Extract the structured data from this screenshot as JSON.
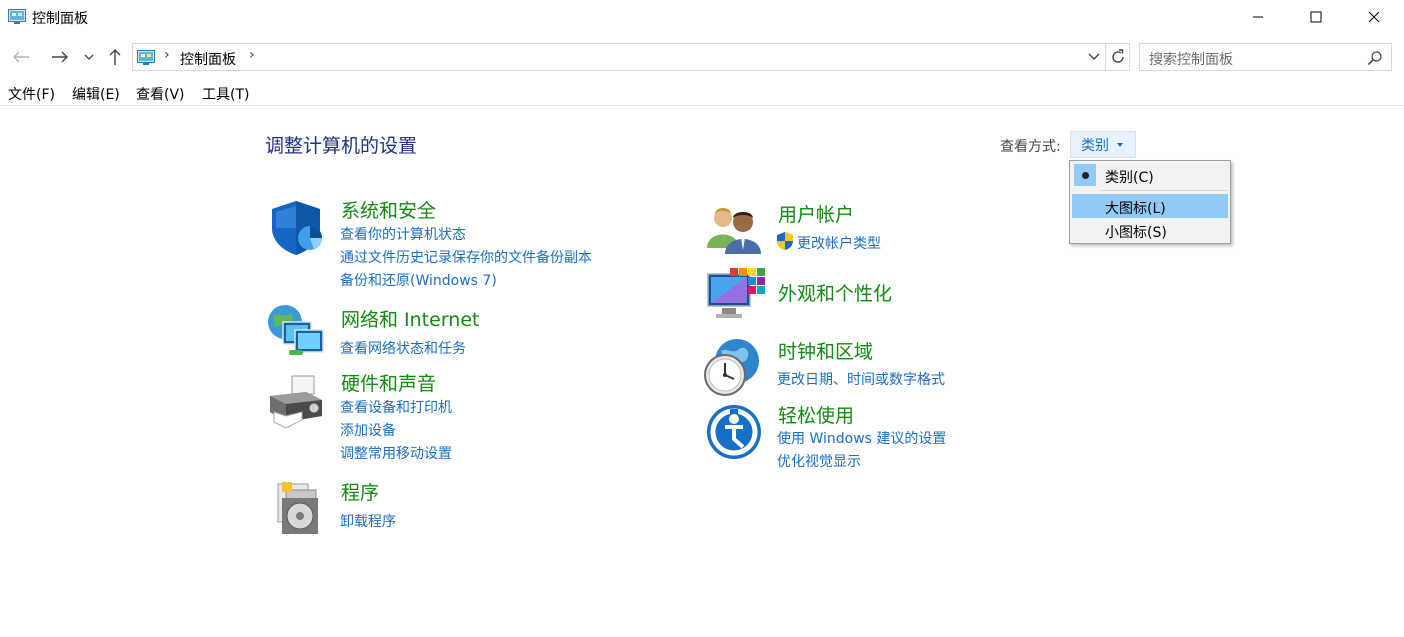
{
  "window": {
    "title": "控制面板"
  },
  "address": {
    "crumb": "控制面板",
    "separator": "›"
  },
  "search": {
    "placeholder": "搜索控制面板"
  },
  "menubar": {
    "file": "文件(F)",
    "edit": "编辑(E)",
    "view": "查看(V)",
    "tools": "工具(T)"
  },
  "main": {
    "title": "调整计算机的设置",
    "view_by_label": "查看方式:",
    "view_by_value": "类别"
  },
  "dropdown": {
    "items": [
      "类别(C)",
      "大图标(L)",
      "小图标(S)"
    ],
    "selected_index": 0,
    "highlighted_index": 1
  },
  "categories": {
    "security": {
      "title": "系统和安全",
      "links": [
        "查看你的计算机状态",
        "通过文件历史记录保存你的文件备份副本",
        "备份和还原(Windows 7)"
      ]
    },
    "network": {
      "title": "网络和 Internet",
      "links": [
        "查看网络状态和任务"
      ]
    },
    "hardware": {
      "title": "硬件和声音",
      "links": [
        "查看设备和打印机",
        "添加设备",
        "调整常用移动设置"
      ]
    },
    "programs": {
      "title": "程序",
      "links": [
        "卸载程序"
      ]
    },
    "accounts": {
      "title": "用户帐户",
      "links": [
        "更改帐户类型"
      ]
    },
    "appearance": {
      "title": "外观和个性化",
      "links": []
    },
    "clock": {
      "title": "时钟和区域",
      "links": [
        "更改日期、时间或数字格式"
      ]
    },
    "ease": {
      "title": "轻松使用",
      "links": [
        "使用 Windows 建议的设置",
        "优化视觉显示"
      ]
    }
  },
  "colors": {
    "category_title": "#138a11",
    "link": "#1a6ec7",
    "page_title": "#1e3287",
    "menu_highlight": "#91c9f7"
  },
  "icons": {
    "security": "shield-icon",
    "network": "network-globe-icon",
    "hardware": "printer-icon",
    "programs": "program-disc-icon",
    "accounts": "users-icon",
    "appearance": "monitor-palette-icon",
    "clock": "clock-globe-icon",
    "ease": "ease-of-access-icon"
  }
}
